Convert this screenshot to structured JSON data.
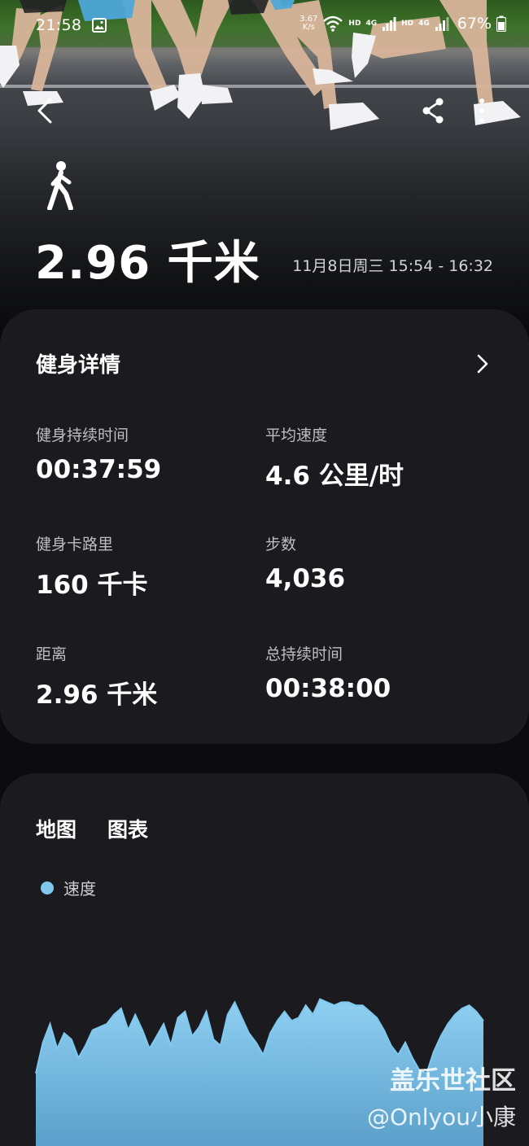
{
  "status_bar": {
    "time": "21:58",
    "net_speed_value": "3.67",
    "net_speed_unit": "K/s",
    "hd1": "HD",
    "network1": "4G",
    "hd2": "HD",
    "network2": "4G",
    "battery": "67%"
  },
  "header": {
    "activity_icon": "walk-icon",
    "distance": "2.96 千米",
    "date_range": "11月8日周三 15:54 - 16:32",
    "icons": [
      "back-icon",
      "share-icon",
      "more-icon"
    ]
  },
  "details": {
    "title": "健身详情",
    "stats": [
      {
        "label": "健身持续时间",
        "value": "00:37:59"
      },
      {
        "label": "平均速度",
        "value": "4.6 公里/时"
      },
      {
        "label": "健身卡路里",
        "value": "160 千卡"
      },
      {
        "label": "步数",
        "value": "4,036"
      },
      {
        "label": "距离",
        "value": "2.96 千米"
      },
      {
        "label": "总持续时间",
        "value": "00:38:00"
      }
    ]
  },
  "chart_card": {
    "tabs": [
      "地图",
      "图表"
    ],
    "legend": "速度",
    "color": "#7fc8ee"
  },
  "chart_data": {
    "type": "area",
    "title": "",
    "xlabel": "",
    "ylabel": "",
    "series": [
      {
        "name": "速度",
        "values": [
          2.4,
          3.4,
          4.0,
          3.2,
          3.7,
          3.5,
          2.9,
          3.3,
          3.8,
          3.9,
          4.0,
          4.3,
          4.5,
          3.8,
          4.3,
          3.8,
          3.2,
          3.6,
          4.0,
          3.3,
          4.2,
          4.4,
          3.6,
          3.9,
          4.4,
          3.5,
          3.3,
          4.3,
          4.7,
          4.2,
          3.7,
          3.4,
          3.0,
          3.7,
          4.1,
          4.4,
          4.1,
          4.2,
          4.6,
          4.3,
          4.8,
          4.7,
          4.6,
          4.7,
          4.7,
          4.6,
          4.6,
          4.4,
          4.2,
          3.8,
          3.3,
          3.0,
          3.4,
          2.9,
          2.5,
          2.4,
          3.1,
          3.6,
          4.0,
          4.3,
          4.5,
          4.6,
          4.4,
          4.1
        ]
      }
    ],
    "grid": false,
    "legend_position": "top-left"
  },
  "watermark": {
    "line1": "盖乐世社区",
    "line2": "@Onlyou小康"
  }
}
